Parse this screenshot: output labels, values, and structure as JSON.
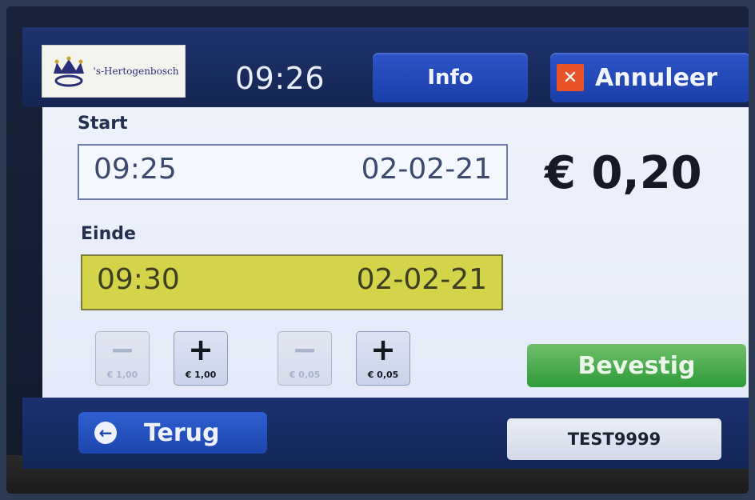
{
  "header": {
    "logo_text": "'s-Hertogenbosch",
    "clock": "09:26",
    "info_label": "Info",
    "cancel_label": "Annuleer",
    "cancel_icon": "close-icon"
  },
  "start": {
    "label": "Start",
    "time": "09:25",
    "date": "02-02-21"
  },
  "end": {
    "label": "Einde",
    "time": "09:30",
    "date": "02-02-21"
  },
  "price": "€ 0,20",
  "steppers": [
    {
      "symbol": "−",
      "amount": "€ 1,00",
      "enabled": false
    },
    {
      "symbol": "+",
      "amount": "€ 1,00",
      "enabled": true
    },
    {
      "symbol": "−",
      "amount": "€ 0,05",
      "enabled": false
    },
    {
      "symbol": "+",
      "amount": "€ 0,05",
      "enabled": true
    }
  ],
  "confirm_label": "Bevestig",
  "footer": {
    "back_label": "Terug",
    "back_icon": "arrow-left-icon",
    "machine_id": "TEST9999"
  },
  "colors": {
    "header_blue": "#1a3ea8",
    "end_field_yellow": "#d4d44a",
    "confirm_green": "#2f9a3a",
    "cancel_red": "#e8532a"
  }
}
